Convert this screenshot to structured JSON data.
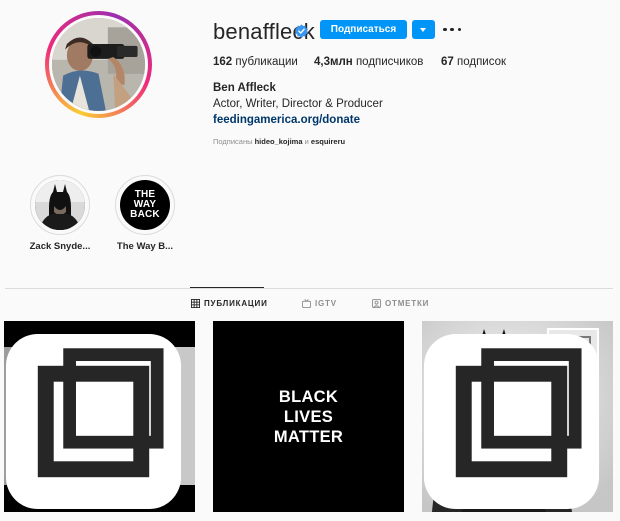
{
  "profile": {
    "username": "benaffleck",
    "verified": true,
    "follow_label": "Подписаться",
    "full_name": "Ben Affleck",
    "bio": "Actor, Writer, Director & Producer",
    "link": "feedingamerica.org/donate",
    "followed_by_prefix": "Подписаны",
    "followed_by_user1": "hideo_kojima",
    "followed_by_and": "и",
    "followed_by_user2": "esquireru"
  },
  "stats": {
    "posts_count": "162",
    "posts_label": "публикации",
    "followers_count": "4,3млн",
    "followers_label": "подписчиков",
    "following_count": "67",
    "following_label": "подписок"
  },
  "highlights": [
    {
      "label": "Zack Snyde...",
      "icon": "batman-cover"
    },
    {
      "label": "The Way B...",
      "icon": "the-way-back-cover",
      "cover_text": [
        "THE",
        "WAY",
        "BACK"
      ]
    }
  ],
  "tabs": [
    {
      "label": "ПУБЛИКАЦИИ",
      "icon": "grid-icon",
      "active": true
    },
    {
      "label": "IGTV",
      "icon": "igtv-icon",
      "active": false
    },
    {
      "label": "ОТМЕТКИ",
      "icon": "tagged-icon",
      "active": false
    }
  ],
  "posts": [
    {
      "kind": "photo",
      "icon": "multi-post-icon"
    },
    {
      "kind": "text",
      "lines": [
        "BLACK",
        "LIVES",
        "MATTER"
      ]
    },
    {
      "kind": "photo",
      "icon": "multi-post-icon"
    }
  ],
  "colors": {
    "accent": "#0095f6",
    "link": "#00376b",
    "muted": "#8e8e8e",
    "background": "#fafafa"
  }
}
